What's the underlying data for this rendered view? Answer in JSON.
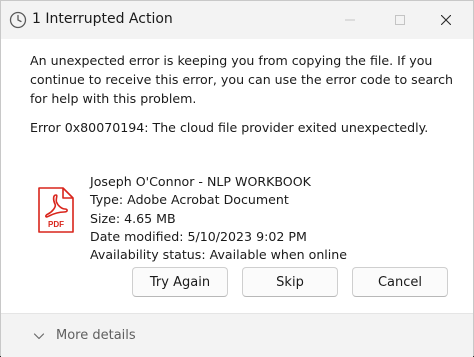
{
  "window": {
    "title": "1 Interrupted Action"
  },
  "dialog": {
    "message": "An unexpected error is keeping you from copying the file. If you continue to receive this error, you can use the error code to search for help with this problem.",
    "error_code": "Error 0x80070194: The cloud file provider exited unexpectedly.",
    "file": {
      "icon": "pdf-icon",
      "icon_label": "PDF",
      "name": "Joseph O'Connor - NLP WORKBOOK",
      "type": "Type: Adobe Acrobat Document",
      "size": "Size: 4.65 MB",
      "modified": "Date modified: 5/10/2023 9:02 PM",
      "availability": "Availability status: Available when online"
    },
    "buttons": {
      "try_again": "Try Again",
      "skip": "Skip",
      "cancel": "Cancel"
    }
  },
  "footer": {
    "more_details": "More details"
  },
  "colors": {
    "pdf_red": "#d9251c",
    "text": "#1a1a1a",
    "footer_text": "#5f5f5f"
  }
}
